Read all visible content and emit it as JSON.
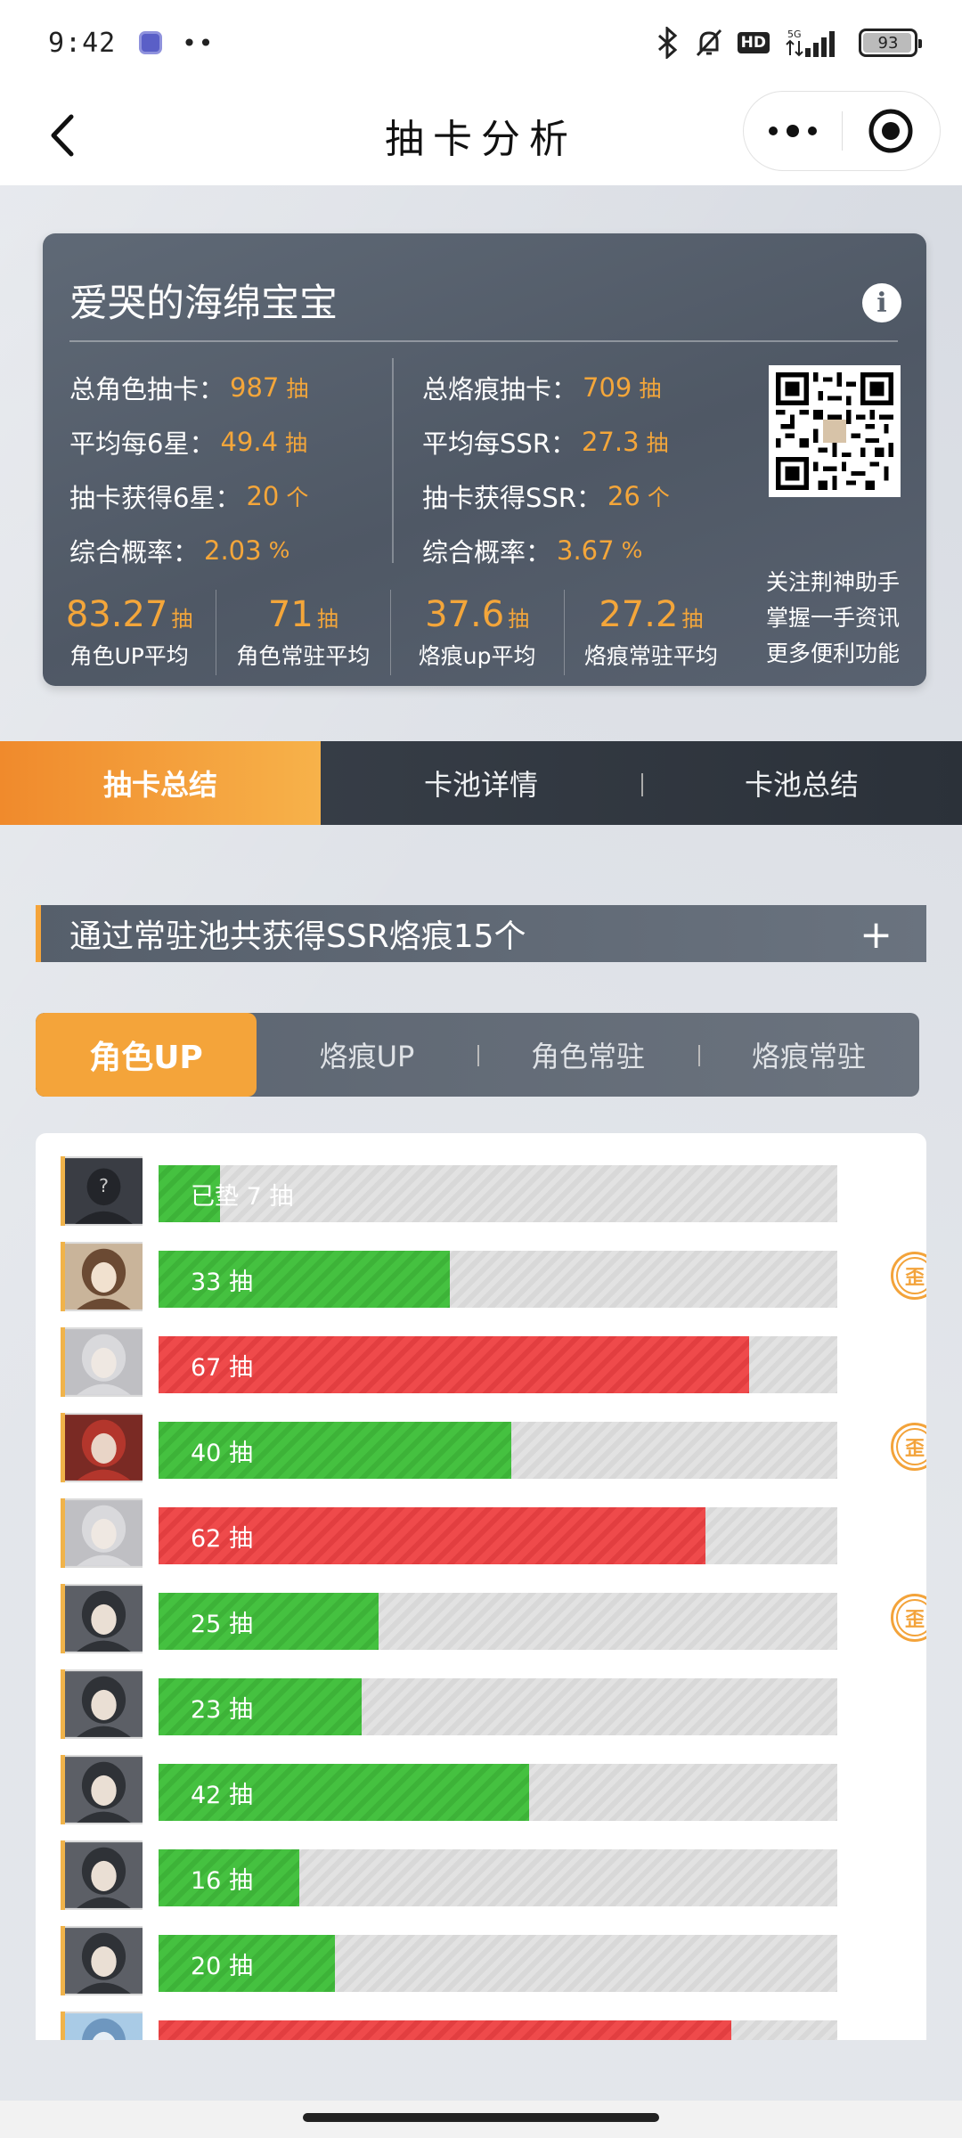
{
  "status_bar": {
    "time": "9:42",
    "more": "••",
    "hd": "HD",
    "network": "5G",
    "battery": "93"
  },
  "nav": {
    "title": "抽卡分析"
  },
  "profile": {
    "name": "爱哭的海绵宝宝",
    "left_stats": [
      {
        "label": "总角色抽卡：",
        "value": "987",
        "unit": "抽"
      },
      {
        "label": "平均每6星：",
        "value": "49.4",
        "unit": "抽"
      },
      {
        "label": "抽卡获得6星：",
        "value": "20",
        "unit": "个"
      },
      {
        "label": "综合概率：",
        "value": "2.03",
        "unit": "%"
      }
    ],
    "right_stats": [
      {
        "label": "总烙痕抽卡：",
        "value": "709",
        "unit": "抽"
      },
      {
        "label": "平均每SSR：",
        "value": "27.3",
        "unit": "抽"
      },
      {
        "label": "抽卡获得SSR：",
        "value": "26",
        "unit": "个"
      },
      {
        "label": "综合概率：",
        "value": "3.67",
        "unit": "%"
      }
    ],
    "averages": [
      {
        "value": "83.27",
        "unit": "抽",
        "label": "角色UP平均"
      },
      {
        "value": "71",
        "unit": "抽",
        "label": "角色常驻平均"
      },
      {
        "value": "37.6",
        "unit": "抽",
        "label": "烙痕up平均"
      },
      {
        "value": "27.2",
        "unit": "抽",
        "label": "烙痕常驻平均"
      }
    ],
    "promo": [
      "关注荆神助手",
      "掌握一手资讯",
      "更多便利功能"
    ]
  },
  "main_tabs": [
    "抽卡总结",
    "卡池详情",
    "卡池总结"
  ],
  "section": {
    "title": "通过常驻池共获得SSR烙痕15个",
    "toggle": "+"
  },
  "sub_tabs": [
    "角色UP",
    "烙痕UP",
    "角色常驻",
    "烙痕常驻"
  ],
  "pulls": [
    {
      "label": "已垫 7 抽",
      "count": 7,
      "color": "green",
      "lost": false,
      "avatar": "unknown"
    },
    {
      "label": "33 抽",
      "count": 33,
      "color": "green",
      "lost": true,
      "avatar": "brown-hair"
    },
    {
      "label": "67 抽",
      "count": 67,
      "color": "red",
      "lost": false,
      "avatar": "silver-hair"
    },
    {
      "label": "40 抽",
      "count": 40,
      "color": "green",
      "lost": true,
      "avatar": "red-hair"
    },
    {
      "label": "62 抽",
      "count": 62,
      "color": "red",
      "lost": false,
      "avatar": "silver-hair"
    },
    {
      "label": "25 抽",
      "count": 25,
      "color": "green",
      "lost": true,
      "avatar": "dark-hair"
    },
    {
      "label": "23 抽",
      "count": 23,
      "color": "green",
      "lost": false,
      "avatar": "dark-hair"
    },
    {
      "label": "42 抽",
      "count": 42,
      "color": "green",
      "lost": false,
      "avatar": "dark-hair"
    },
    {
      "label": "16 抽",
      "count": 16,
      "color": "green",
      "lost": false,
      "avatar": "dark-hair"
    },
    {
      "label": "20 抽",
      "count": 20,
      "color": "green",
      "lost": false,
      "avatar": "dark-hair"
    },
    {
      "label": "",
      "count": 65,
      "color": "red",
      "lost": false,
      "avatar": "blue"
    }
  ],
  "pity_max": 77,
  "lost_badge": "歪",
  "colors": {
    "accent": "#f4a43a",
    "win": "#45c140",
    "lose": "#ef4a4b",
    "card": "#56606c"
  },
  "icons": {
    "back": "chevron-left-icon",
    "menu": "more-dots-icon",
    "close": "target-circle-icon",
    "info": "info-icon",
    "qr": "qr-code-icon",
    "badge": "lost-5050-badge-icon"
  }
}
